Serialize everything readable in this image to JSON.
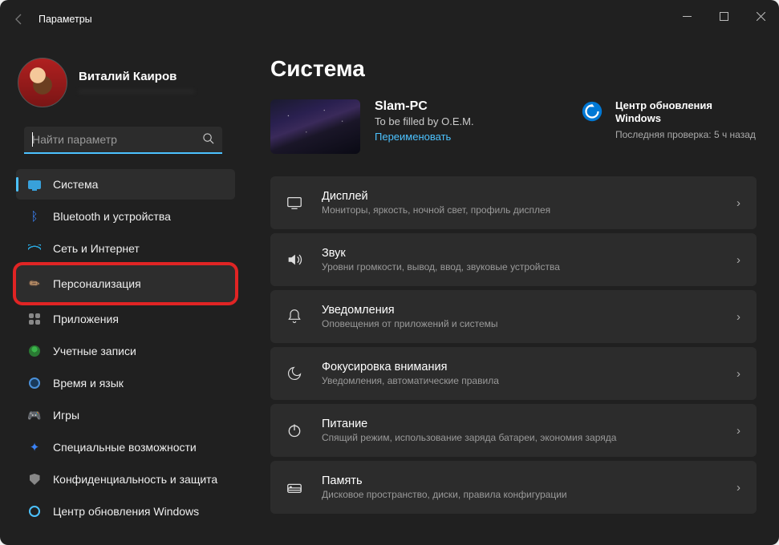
{
  "titlebar": {
    "title": "Параметры"
  },
  "user": {
    "name": "Виталий Каиров",
    "email": "————————————"
  },
  "search": {
    "placeholder": "Найти параметр"
  },
  "nav": [
    {
      "id": "system",
      "label": "Система",
      "icon": "system",
      "selected": true
    },
    {
      "id": "bluetooth",
      "label": "Bluetooth и устройства",
      "icon": "bt"
    },
    {
      "id": "network",
      "label": "Сеть и Интернет",
      "icon": "net"
    },
    {
      "id": "personal",
      "label": "Персонализация",
      "icon": "pers",
      "highlighted": true
    },
    {
      "id": "apps",
      "label": "Приложения",
      "icon": "apps"
    },
    {
      "id": "accounts",
      "label": "Учетные записи",
      "icon": "acct"
    },
    {
      "id": "time",
      "label": "Время и язык",
      "icon": "time"
    },
    {
      "id": "gaming",
      "label": "Игры",
      "icon": "game"
    },
    {
      "id": "access",
      "label": "Специальные возможности",
      "icon": "access"
    },
    {
      "id": "privacy",
      "label": "Конфиденциальность и защита",
      "icon": "priv"
    },
    {
      "id": "update",
      "label": "Центр обновления Windows",
      "icon": "upd"
    }
  ],
  "main": {
    "heading": "Система",
    "pc": {
      "name": "Slam-PC",
      "oem": "To be filled by O.E.M.",
      "rename": "Переименовать"
    },
    "update_card": {
      "title": "Центр обновления Windows",
      "subtitle": "Последняя проверка: 5 ч назад"
    },
    "items": [
      {
        "id": "display",
        "title": "Дисплей",
        "sub": "Мониторы, яркость, ночной свет, профиль дисплея",
        "icon": "display"
      },
      {
        "id": "sound",
        "title": "Звук",
        "sub": "Уровни громкости, вывод, ввод, звуковые устройства",
        "icon": "sound"
      },
      {
        "id": "notif",
        "title": "Уведомления",
        "sub": "Оповещения от приложений и системы",
        "icon": "bell"
      },
      {
        "id": "focus",
        "title": "Фокусировка внимания",
        "sub": "Уведомления, автоматические правила",
        "icon": "moon"
      },
      {
        "id": "power",
        "title": "Питание",
        "sub": "Спящий режим, использование заряда батареи, экономия заряда",
        "icon": "power"
      },
      {
        "id": "storage",
        "title": "Память",
        "sub": "Дисковое пространство, диски, правила конфигурации",
        "icon": "drive"
      }
    ]
  }
}
